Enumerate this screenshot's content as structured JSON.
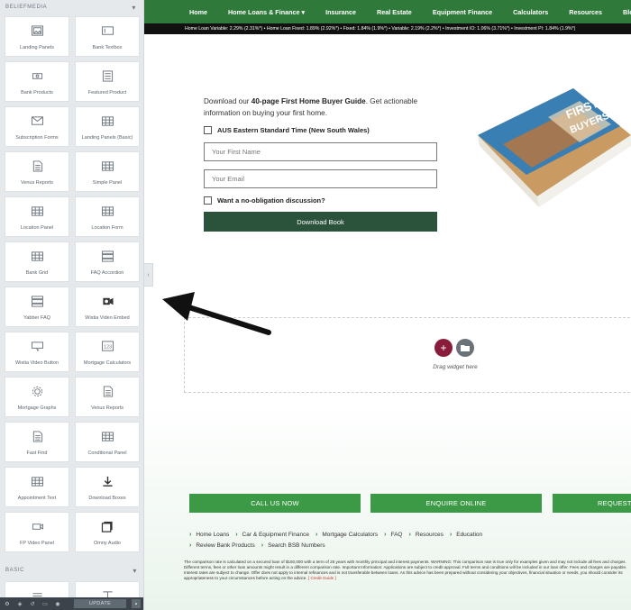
{
  "sidebar": {
    "section_title": "BELIEFMEDIA",
    "widgets": [
      {
        "label": "Landing Panels",
        "icon": "image-icon"
      },
      {
        "label": "Bank Textbox",
        "icon": "textbox-icon"
      },
      {
        "label": "Bank Products",
        "icon": "card-icon"
      },
      {
        "label": "Featured Product",
        "icon": "document-list-icon"
      },
      {
        "label": "Subscription Forms",
        "icon": "envelope-icon"
      },
      {
        "label": "Landing Panels (Basic)",
        "icon": "grid-icon"
      },
      {
        "label": "Venus Reports",
        "icon": "report-icon"
      },
      {
        "label": "Simple Panel",
        "icon": "grid-icon"
      },
      {
        "label": "Location Panel",
        "icon": "grid-icon"
      },
      {
        "label": "Location Form",
        "icon": "grid-icon"
      },
      {
        "label": "Bank Grid",
        "icon": "grid-icon"
      },
      {
        "label": "FAQ Accordion",
        "icon": "accordion-icon"
      },
      {
        "label": "Yabber FAQ",
        "icon": "accordion-icon"
      },
      {
        "label": "Wistia Video Embed",
        "icon": "video-camera-icon"
      },
      {
        "label": "Wistia Video Button",
        "icon": "video-button-icon"
      },
      {
        "label": "Mortgage Calculators",
        "icon": "calculator-icon"
      },
      {
        "label": "Mortgage Graphs",
        "icon": "gear-icon"
      },
      {
        "label": "Venus Reports",
        "icon": "report-icon"
      },
      {
        "label": "Fast Find",
        "icon": "report-icon"
      },
      {
        "label": "Conditional Panel",
        "icon": "grid-icon"
      },
      {
        "label": "Appointment Text",
        "icon": "grid-icon"
      },
      {
        "label": "Download Boxes",
        "icon": "download-icon"
      },
      {
        "label": "FP Video Panel",
        "icon": "video-panel-icon"
      },
      {
        "label": "Omny Audio",
        "icon": "audio-icon"
      }
    ],
    "basic_title": "BASIC",
    "basic_widgets": [
      {
        "icon": "section-icon"
      },
      {
        "icon": "heading-icon"
      }
    ],
    "update_label": "UPDATE"
  },
  "nav": {
    "items": [
      "Home",
      "Home Loans & Finance",
      "Insurance",
      "Real Estate",
      "Equipment Finance",
      "Calculators",
      "Resources",
      "Blog"
    ],
    "dropdown_marker": "▾"
  },
  "ticker": "Home Loan Variable: 2.29% (2.31%*) • Home Loan Fixed: 1.89% (2.92%*) • Fixed: 1.84% (1.9%*) • Variable: 2.19% (2.2%*) • Investment IO: 1.06% (3.71%*) • Investment PI: 1.84% (1.9%*)",
  "promo": {
    "lead_prefix": "Download our ",
    "lead_bold": "40-page First Home Buyer Guide",
    "lead_suffix": ". Get actionable information on buying your first home.",
    "timezone_label": "AUS Eastern Standard Time (New South Wales)",
    "first_name_placeholder": "Your First Name",
    "email_placeholder": "Your Email",
    "discussion_label": "Want a no-obligation discussion?",
    "download_label": "Download Book"
  },
  "book": {
    "cover_title_1": "FIRST HOM",
    "cover_title_2": "BUYERS GUIDE"
  },
  "drop_zone": {
    "text": "Drag widget here"
  },
  "cta": [
    "CALL US NOW",
    "ENQUIRE ONLINE",
    "REQUEST"
  ],
  "links": {
    "row1": [
      "Home Loans",
      "Car & Equipment Finance",
      "Mortgage Calculators",
      "FAQ",
      "Resources",
      "Education"
    ],
    "row2": [
      "Review Bank Products",
      "Search BSB Numbers"
    ]
  },
  "disclaimer": {
    "text": "The comparison rate is calculated on a secured loan of $150,000 with a term of 25 years with monthly principal and interest payments. WARNING: This comparison rate is true only for examples given and may not include all fees and charges. Different terms, fees or other loan amounts might result in a different comparison rate. Important Information: Applications are subject to credit approval. Full terms and conditions will be included in our loan offer. Fees and charges are payable. Interest rates are subject to change. Offer does not apply to internal refinances and is not transferable between loans. As this advice has been prepared without considering your objectives, financial situation or needs, you should consider its appropriateness to your circumstances before acting on the advice. ",
    "link": "[ Credit Guide ]"
  },
  "colors": {
    "nav_green": "#2f7a3a",
    "cta_green": "#3c9a47",
    "download_green": "#2b523b",
    "add_red": "#8a1c3b"
  }
}
